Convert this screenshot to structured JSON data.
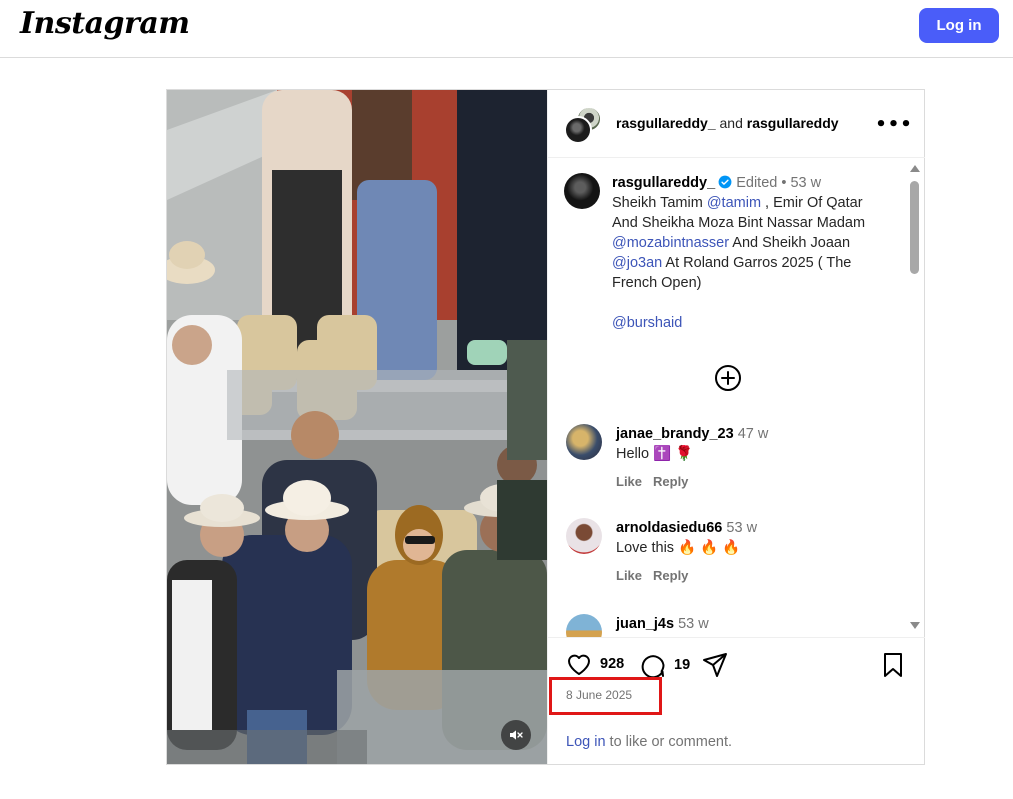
{
  "header": {
    "logo_text": "Instagram",
    "login_label": "Log in"
  },
  "post": {
    "authors": {
      "first": "rasgullareddy_",
      "joiner": "and",
      "second": "rasgullareddy"
    },
    "more_label": "•••",
    "caption": {
      "username": "rasgullareddy_",
      "edited": "Edited",
      "dot": "•",
      "age": "53 w",
      "t1": "Sheikh Tamim ",
      "m1": "@tamim",
      "t2": " , Emir Of Qatar",
      "line2": "And Sheikha Moza Bint Nassar Madam",
      "m2": "@mozabintnasser",
      "t3": " And Sheikh Joaan",
      "m3": "@jo3an",
      "t4": " At Roland Garros 2025 ( The",
      "line5": "French Open)",
      "m4": "@burshaid"
    },
    "comments": [
      {
        "username": "janae_brandy_23",
        "age": "47 w",
        "text": "Hello ✝️ 🌹",
        "like": "Like",
        "reply": "Reply"
      },
      {
        "username": "arnoldasiedu66",
        "age": "53 w",
        "text": "Love this 🔥 🔥 🔥",
        "like": "Like",
        "reply": "Reply"
      },
      {
        "username": "juan_j4s",
        "age": "53 w"
      }
    ],
    "likes_count": "928",
    "comments_count": "19",
    "date": "8 June 2025",
    "login_prompt": {
      "link": "Log in",
      "rest": " to like or comment."
    }
  },
  "colors": {
    "accent": "#4a5df9",
    "mention": "#3d55b8",
    "highlight": "#e01717",
    "muted": "#737373"
  },
  "icons": [
    "heart-icon",
    "comment-icon",
    "share-icon",
    "bookmark-icon",
    "add-circle-icon",
    "mute-icon",
    "verified-icon"
  ]
}
